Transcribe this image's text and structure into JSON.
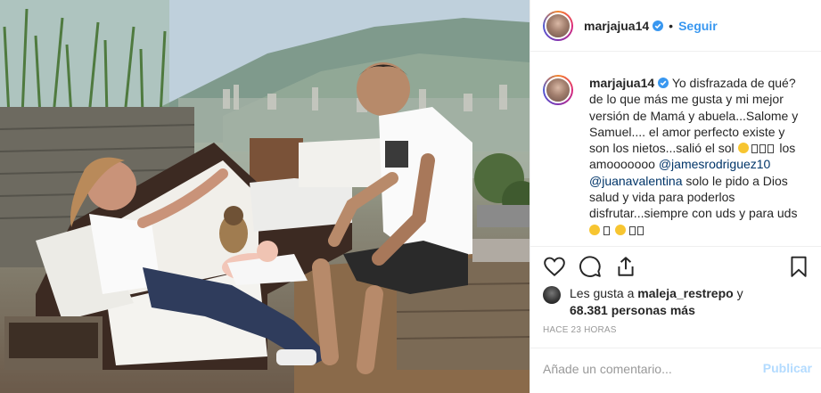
{
  "post": {
    "username": "marjajua14",
    "follow_label": "Seguir",
    "separator": "•",
    "caption_lines": [
      "Yo disfrazada de qué?",
      "de lo que más me gusta y mi mejor",
      "versión de Mamá y abuela...Salome y",
      "Samuel.... el amor perfecto existe y son",
      "los nietos...salió el sol"
    ],
    "caption_emoji_tail": "los",
    "caption_amo": "amooooooo",
    "mention_1": "@jamesrodriguez10",
    "mention_2": "@juanavalentina",
    "caption_after_mention": "solo le pido a Dios",
    "caption_line_salud": "salud y vida para poderlos",
    "caption_line_disfrutar": "disfrutar...siempre con uds y para uds",
    "likes_prefix": "Les gusta a",
    "likes_user": "maleja_restrepo",
    "likes_and": "y",
    "likes_count": "68.381 personas más",
    "time_ago": "HACE 23 HORAS",
    "comment_placeholder": "Añade un comentario...",
    "publish_label": "Publicar"
  },
  "icons": [
    "verified-badge-icon",
    "heart-icon",
    "comment-icon",
    "share-icon",
    "bookmark-icon"
  ],
  "colors": {
    "link": "#3897f0",
    "mention": "#003569",
    "muted": "#999999",
    "publish_disabled": "#b3dbff"
  }
}
